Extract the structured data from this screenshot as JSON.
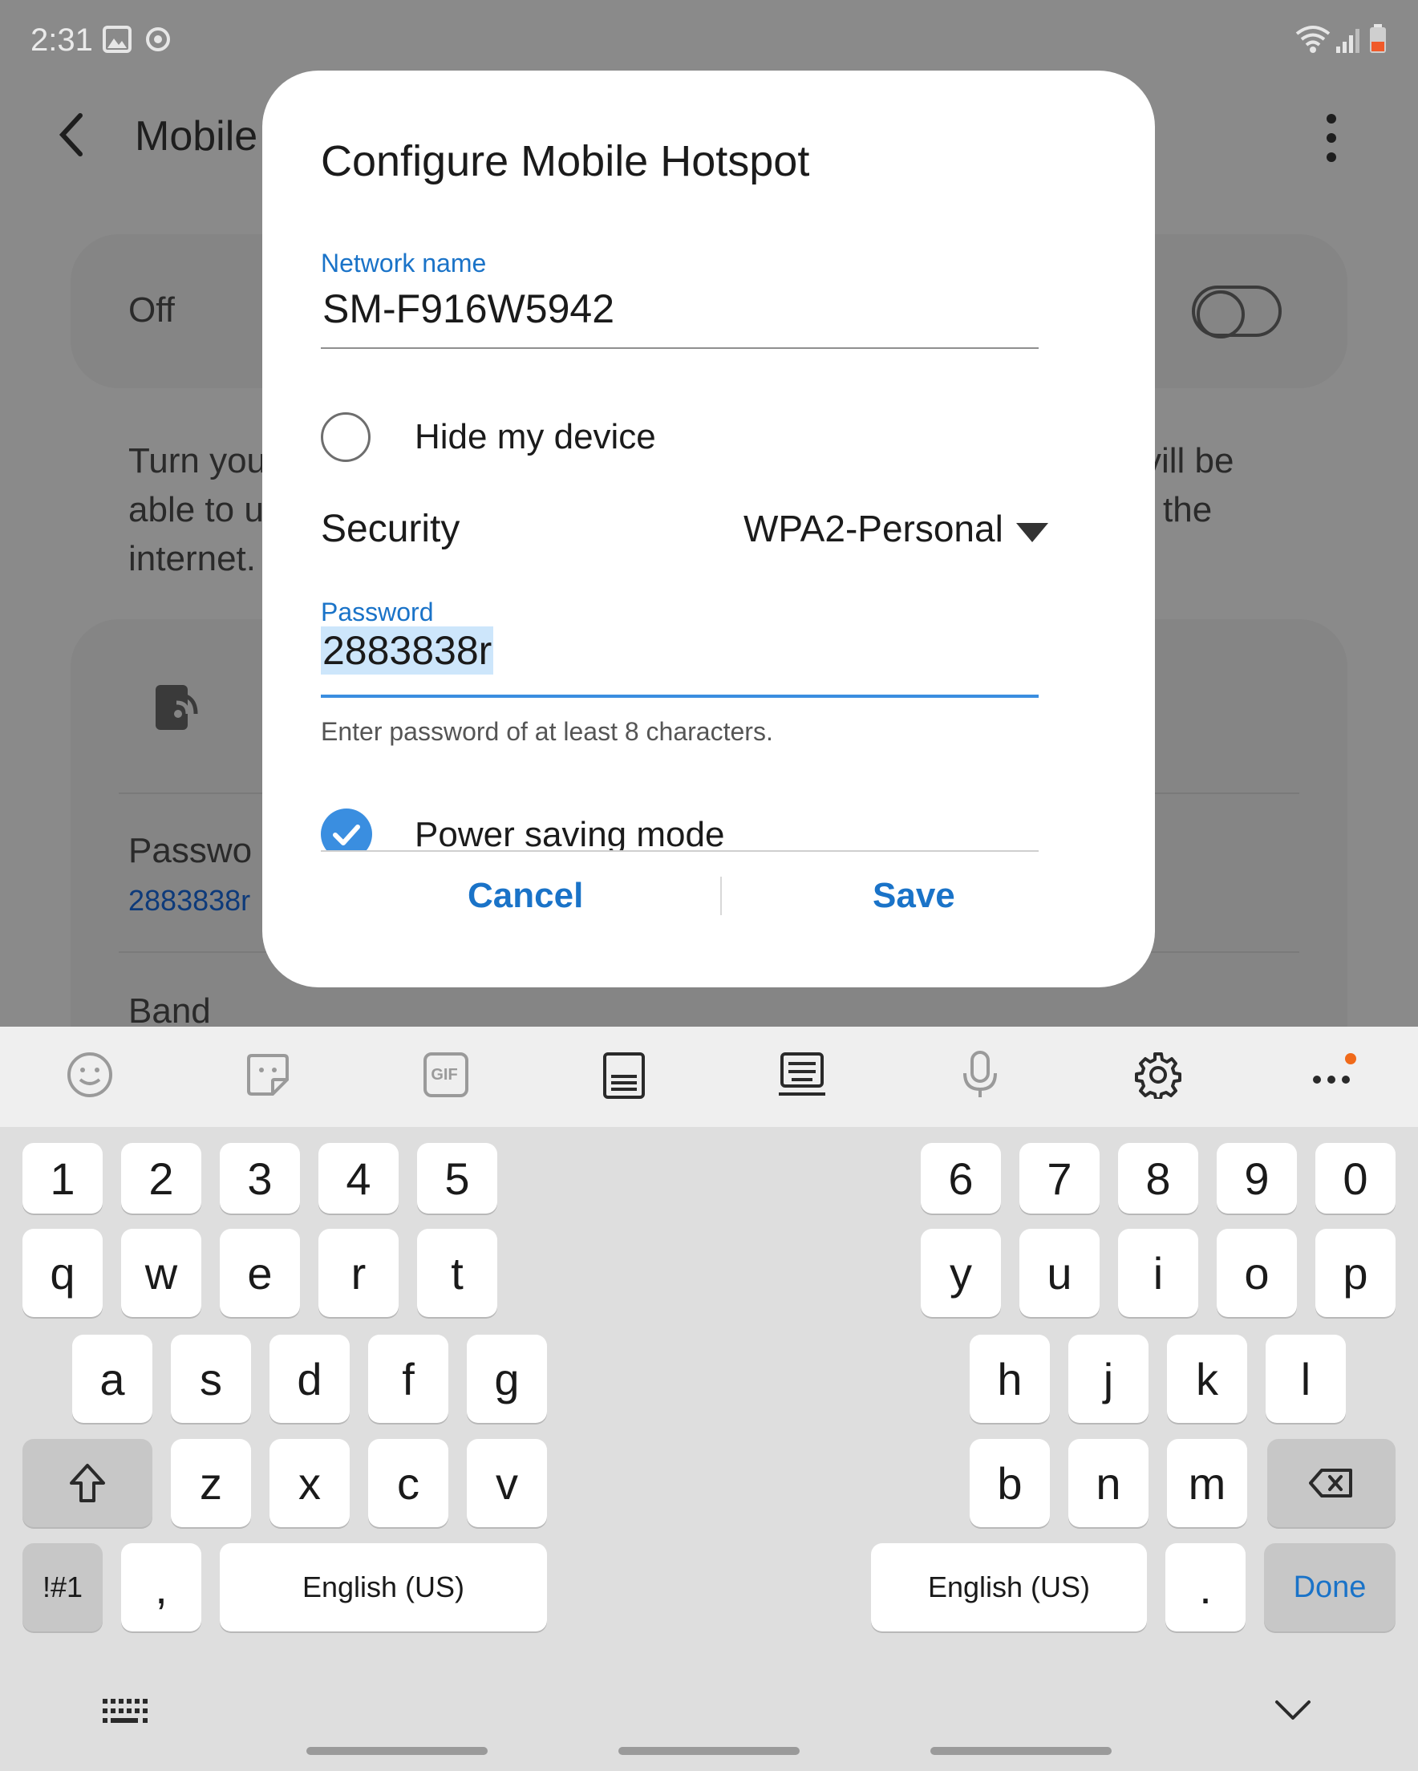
{
  "status_bar": {
    "time": "2:31"
  },
  "background": {
    "title": "Mobile",
    "toggle_state": "Off",
    "description_left": [
      "Turn you",
      "able to u",
      "internet."
    ],
    "description_right": [
      "vill be",
      "the"
    ],
    "password_label": "Passwo",
    "password_value": "2883838r",
    "band_label": "Band"
  },
  "dialog": {
    "title": "Configure Mobile Hotspot",
    "network_name_label": "Network name",
    "network_name_value": "SM-F916W5942",
    "hide_device_label": "Hide my device",
    "hide_device_checked": false,
    "security_label": "Security",
    "security_value": "WPA2-Personal",
    "password_label": "Password",
    "password_value": "2883838r",
    "password_hint": "Enter password of at least 8 characters.",
    "power_saving_label": "Power saving mode",
    "power_saving_checked": true,
    "cancel_label": "Cancel",
    "save_label": "Save"
  },
  "keyboard": {
    "toolbar_icons": [
      "emoji-icon",
      "sticker-icon",
      "gif-icon",
      "keypad-icon",
      "keyboard-icon",
      "microphone-icon",
      "settings-icon",
      "more-icon"
    ],
    "gif_text": "GIF",
    "left": {
      "row1": [
        "1",
        "2",
        "3",
        "4",
        "5"
      ],
      "row2": [
        "q",
        "w",
        "e",
        "r",
        "t"
      ],
      "row3": [
        "a",
        "s",
        "d",
        "f",
        "g"
      ],
      "row4": [
        "z",
        "x",
        "c",
        "v"
      ],
      "symbols": "!#1",
      "comma": ",",
      "space": "English (US)"
    },
    "right": {
      "row1": [
        "6",
        "7",
        "8",
        "9",
        "0"
      ],
      "row2": [
        "y",
        "u",
        "i",
        "o",
        "p"
      ],
      "row3": [
        "h",
        "j",
        "k",
        "l"
      ],
      "row4": [
        "b",
        "n",
        "m"
      ],
      "space": "English (US)",
      "period": ".",
      "done": "Done"
    }
  },
  "colors": {
    "accent": "#1a73c8",
    "dim_overlay": "#8a8a8a",
    "dialog_bg": "#ffffff",
    "keyboard_bg": "#dedede"
  }
}
